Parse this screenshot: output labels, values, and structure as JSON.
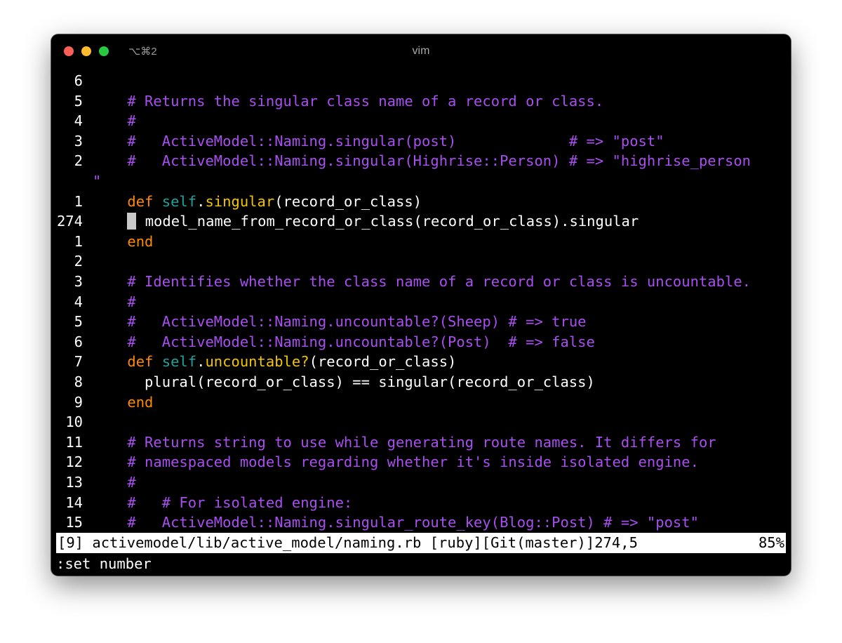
{
  "window": {
    "shortcut": "⌥⌘2",
    "title": "vim"
  },
  "lines": [
    {
      "number": "6",
      "segments": []
    },
    {
      "number": "5",
      "segments": [
        {
          "text": "    ",
          "cls": ""
        },
        {
          "text": "# Returns the singular class name of a record or class.",
          "cls": "comment"
        }
      ]
    },
    {
      "number": "4",
      "segments": [
        {
          "text": "    ",
          "cls": ""
        },
        {
          "text": "#",
          "cls": "comment"
        }
      ]
    },
    {
      "number": "3",
      "segments": [
        {
          "text": "    ",
          "cls": ""
        },
        {
          "text": "#   ActiveModel::Naming.singular(post)             # => \"post\"",
          "cls": "comment"
        }
      ]
    },
    {
      "number": "2",
      "segments": [
        {
          "text": "    ",
          "cls": ""
        },
        {
          "text": "#   ActiveModel::Naming.singular(Highrise::Person) # => \"highrise_person",
          "cls": "comment"
        }
      ]
    },
    {
      "number": "",
      "segments": [
        {
          "text": "\"",
          "cls": "comment"
        }
      ],
      "wrap": true
    },
    {
      "number": "1",
      "segments": [
        {
          "text": "    ",
          "cls": ""
        },
        {
          "text": "def",
          "cls": "kw"
        },
        {
          "text": " ",
          "cls": ""
        },
        {
          "text": "self",
          "cls": "self"
        },
        {
          "text": ".",
          "cls": ""
        },
        {
          "text": "singular",
          "cls": "meth"
        },
        {
          "text": "(record_or_class)",
          "cls": ""
        }
      ]
    },
    {
      "number": "274",
      "cursor": true,
      "segments": [
        {
          "text": "    ",
          "cls": ""
        },
        {
          "text": "",
          "cls": "cursor"
        },
        {
          "text": " model_name_from_record_or_class(record_or_class).singular",
          "cls": ""
        }
      ]
    },
    {
      "number": "1",
      "segments": [
        {
          "text": "    ",
          "cls": ""
        },
        {
          "text": "end",
          "cls": "kw"
        }
      ]
    },
    {
      "number": "2",
      "segments": []
    },
    {
      "number": "3",
      "segments": [
        {
          "text": "    ",
          "cls": ""
        },
        {
          "text": "# Identifies whether the class name of a record or class is uncountable.",
          "cls": "comment"
        }
      ]
    },
    {
      "number": "4",
      "segments": [
        {
          "text": "    ",
          "cls": ""
        },
        {
          "text": "#",
          "cls": "comment"
        }
      ]
    },
    {
      "number": "5",
      "segments": [
        {
          "text": "    ",
          "cls": ""
        },
        {
          "text": "#   ActiveModel::Naming.uncountable?(Sheep) # => true",
          "cls": "comment"
        }
      ]
    },
    {
      "number": "6",
      "segments": [
        {
          "text": "    ",
          "cls": ""
        },
        {
          "text": "#   ActiveModel::Naming.uncountable?(Post)  # => false",
          "cls": "comment"
        }
      ]
    },
    {
      "number": "7",
      "segments": [
        {
          "text": "    ",
          "cls": ""
        },
        {
          "text": "def",
          "cls": "kw"
        },
        {
          "text": " ",
          "cls": ""
        },
        {
          "text": "self",
          "cls": "self"
        },
        {
          "text": ".",
          "cls": ""
        },
        {
          "text": "uncountable?",
          "cls": "meth"
        },
        {
          "text": "(record_or_class)",
          "cls": ""
        }
      ]
    },
    {
      "number": "8",
      "segments": [
        {
          "text": "      plural(record_or_class) == singular(record_or_class)",
          "cls": ""
        }
      ]
    },
    {
      "number": "9",
      "segments": [
        {
          "text": "    ",
          "cls": ""
        },
        {
          "text": "end",
          "cls": "kw"
        }
      ]
    },
    {
      "number": "10",
      "segments": []
    },
    {
      "number": "11",
      "segments": [
        {
          "text": "    ",
          "cls": ""
        },
        {
          "text": "# Returns string to use while generating route names. It differs for",
          "cls": "comment"
        }
      ]
    },
    {
      "number": "12",
      "segments": [
        {
          "text": "    ",
          "cls": ""
        },
        {
          "text": "# namespaced models regarding whether it's inside isolated engine.",
          "cls": "comment"
        }
      ]
    },
    {
      "number": "13",
      "segments": [
        {
          "text": "    ",
          "cls": ""
        },
        {
          "text": "#",
          "cls": "comment"
        }
      ]
    },
    {
      "number": "14",
      "segments": [
        {
          "text": "    ",
          "cls": ""
        },
        {
          "text": "#   # For isolated engine:",
          "cls": "comment"
        }
      ]
    },
    {
      "number": "15",
      "segments": [
        {
          "text": "    ",
          "cls": ""
        },
        {
          "text": "#   ActiveModel::Naming.singular_route_key(Blog::Post) # => \"post\"",
          "cls": "comment"
        }
      ]
    }
  ],
  "statusline": {
    "left": "[9] activemodel/lib/active_model/naming.rb [ruby][Git(master)]274,5",
    "right": "85%"
  },
  "cmdline": {
    "text": ":set number"
  }
}
